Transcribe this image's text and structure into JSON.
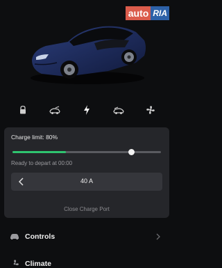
{
  "header": {
    "partial_text": "· · · · · ·"
  },
  "watermark": {
    "part1": "auto",
    "part2": "RIA"
  },
  "car": {
    "image_alt": "tesla-model-s-blue",
    "body_color": "#1c2a5a"
  },
  "quick_controls": [
    {
      "icon": "lock-icon"
    },
    {
      "icon": "trunk-icon"
    },
    {
      "icon": "charge-icon",
      "active": true
    },
    {
      "icon": "frunk-icon"
    },
    {
      "icon": "fan-icon"
    }
  ],
  "charge": {
    "limit_label": "Charge limit: 80%",
    "limit_value": 0.8,
    "current_level": 0.36,
    "depart_text": "Ready to depart at 00:00",
    "amps": "40 A",
    "close_port_label": "Close Charge Port",
    "accent_color": "#2fc46f"
  },
  "menu": [
    {
      "label": "Controls",
      "icon": "car-icon"
    },
    {
      "label": "Climate",
      "icon": "fan-icon"
    }
  ]
}
